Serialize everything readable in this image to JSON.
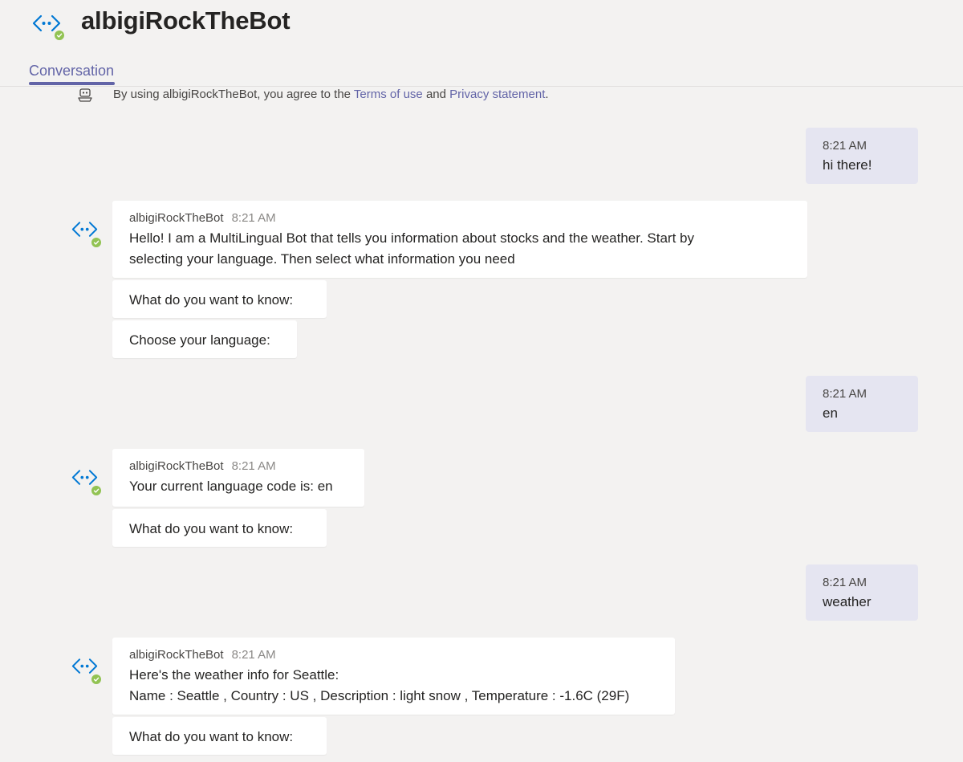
{
  "header": {
    "title": "albigiRockTheBot",
    "tabs": [
      {
        "label": "Conversation",
        "active": true
      }
    ],
    "presence": "available"
  },
  "consent": {
    "prefix": "By using albigiRockTheBot, you agree to the ",
    "terms_link": "Terms of use",
    "middle": " and ",
    "privacy_link": "Privacy statement",
    "suffix": "."
  },
  "colors": {
    "accent": "#6264a7",
    "background": "#f3f2f1",
    "my_bubble": "#e5e5f1",
    "bot_card": "#ffffff",
    "presence_green": "#92c353",
    "bot_icon_blue": "#0078d4"
  },
  "messages": [
    {
      "from": "me",
      "time": "8:21 AM",
      "text": "hi there!"
    },
    {
      "from": "bot",
      "sender": "albigiRockTheBot",
      "time": "8:21 AM",
      "lines": [
        "Hello! I am a MultiLingual Bot that tells you information about stocks and the weather. Start by",
        "selecting your language. Then select what information you need"
      ]
    },
    {
      "from": "bot-card",
      "text": "What do you want to know:"
    },
    {
      "from": "bot-card",
      "text": "Choose your language:"
    },
    {
      "from": "me",
      "time": "8:21 AM",
      "text": "en"
    },
    {
      "from": "bot",
      "sender": "albigiRockTheBot",
      "time": "8:21 AM",
      "lines": [
        "Your current language code is: en"
      ]
    },
    {
      "from": "bot-card",
      "text": "What do you want to know:"
    },
    {
      "from": "me",
      "time": "8:21 AM",
      "text": "weather"
    },
    {
      "from": "bot",
      "sender": "albigiRockTheBot",
      "time": "8:21 AM",
      "lines": [
        "Here's the weather info for Seattle:",
        "Name : Seattle , Country : US , Description : light snow , Temperature : -1.6C (29F)"
      ]
    },
    {
      "from": "bot-card",
      "text": "What do you want to know:"
    }
  ]
}
